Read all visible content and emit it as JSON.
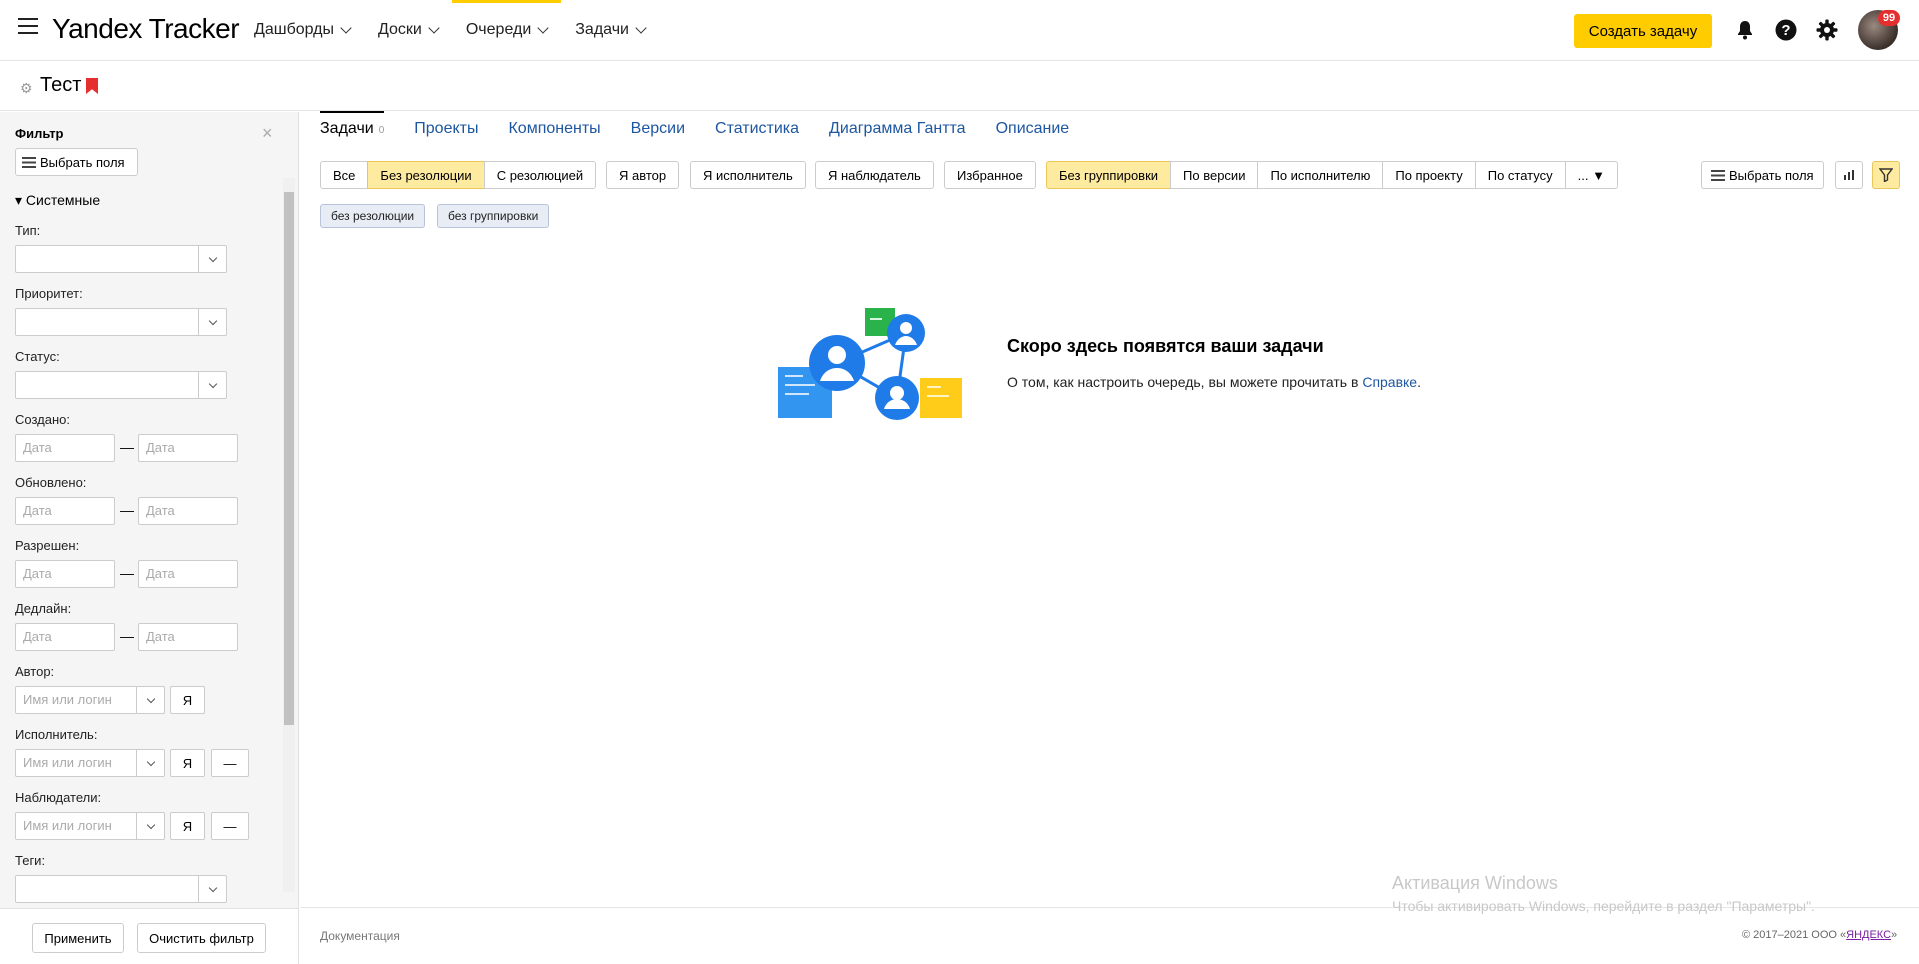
{
  "app": {
    "logo": "Yandex Tracker"
  },
  "nav": {
    "items": [
      "Дашборды",
      "Доски",
      "Очереди",
      "Задачи"
    ]
  },
  "topbar": {
    "create_label": "Создать задачу",
    "notifications_count": "99"
  },
  "queue": {
    "title": "Тест"
  },
  "sidebar": {
    "title": "Фильтр",
    "fields_button": "Выбрать поля",
    "section": "Системные",
    "labels": {
      "type": "Тип:",
      "priority": "Приоритет:",
      "status": "Статус:",
      "created": "Создано:",
      "updated": "Обновлено:",
      "resolved": "Разрешен:",
      "deadline": "Дедлайн:",
      "author": "Автор:",
      "assignee": "Исполнитель:",
      "followers": "Наблюдатели:",
      "tags": "Теги:"
    },
    "date_placeholder": "Дата",
    "user_placeholder": "Имя или логин",
    "me_label": "Я",
    "none_label": "—",
    "dash": "—",
    "apply_label": "Применить",
    "clear_label": "Очистить фильтр"
  },
  "tabs": [
    {
      "label": "Задачи",
      "count": "0"
    },
    {
      "label": "Проекты"
    },
    {
      "label": "Компоненты"
    },
    {
      "label": "Версии"
    },
    {
      "label": "Статистика"
    },
    {
      "label": "Диаграмма Гантта"
    },
    {
      "label": "Описание"
    }
  ],
  "filters": {
    "resolution": [
      "Все",
      "Без резолюции",
      "С резолюцией"
    ],
    "author": "Я автор",
    "assignee": "Я исполнитель",
    "follower": "Я наблюдатель",
    "favorite": "Избранное",
    "grouping": [
      "Без группировки",
      "По версии",
      "По исполнителю",
      "По проекту",
      "По статусу",
      "... ▼"
    ],
    "fields_button": "Выбрать поля"
  },
  "chips": [
    "без резолюции",
    "без группировки"
  ],
  "empty": {
    "title": "Скоро здесь появятся ваши задачи",
    "text": "О том, как настроить очередь, вы можете прочитать в ",
    "link": "Справке",
    "text_end": "."
  },
  "footer": {
    "doc_link": "Документация",
    "copyright_pre": "© 2017–2021  ООО «",
    "copyright_link": "ЯНДЕКС",
    "copyright_post": "»"
  },
  "watermark": {
    "title": "Активация Windows",
    "text": "Чтобы активировать Windows, перейдите в раздел \"Параметры\"."
  },
  "colors": {
    "accent": "#ffcc00",
    "link": "#1e56a0",
    "badge": "#e52e2e"
  }
}
